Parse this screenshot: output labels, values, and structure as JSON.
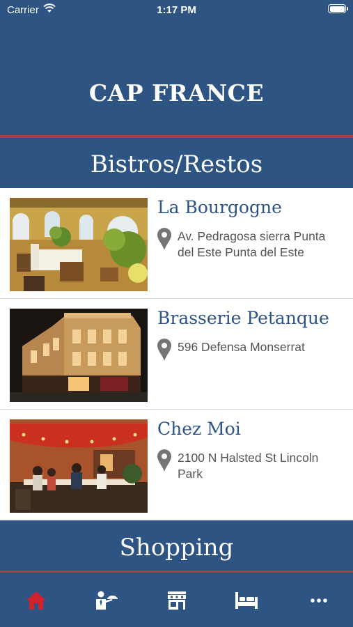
{
  "status_bar": {
    "carrier": "Carrier",
    "time": "1:17 PM"
  },
  "app": {
    "title": "CAP FRANCE"
  },
  "sections": {
    "bistros": "Bistros/Restos",
    "shopping": "Shopping"
  },
  "restaurants": [
    {
      "name": "La Bourgogne",
      "address": "Av. Pedragosa sierra Punta del Este Punta del Este"
    },
    {
      "name": "Brasserie Petanque",
      "address": "596 Defensa Monserrat"
    },
    {
      "name": "Chez Moi",
      "address": "2100 N Halsted St Lincoln Park"
    }
  ],
  "tab_bar": {
    "items": [
      {
        "icon": "home-icon",
        "active": true
      },
      {
        "icon": "waiter-icon",
        "active": false
      },
      {
        "icon": "storefront-icon",
        "active": false
      },
      {
        "icon": "bed-icon",
        "active": false
      },
      {
        "icon": "more-icon",
        "active": false
      }
    ]
  },
  "colors": {
    "primary": "#2d5483",
    "accent": "#b23a48",
    "active_tab": "#d0222d"
  }
}
